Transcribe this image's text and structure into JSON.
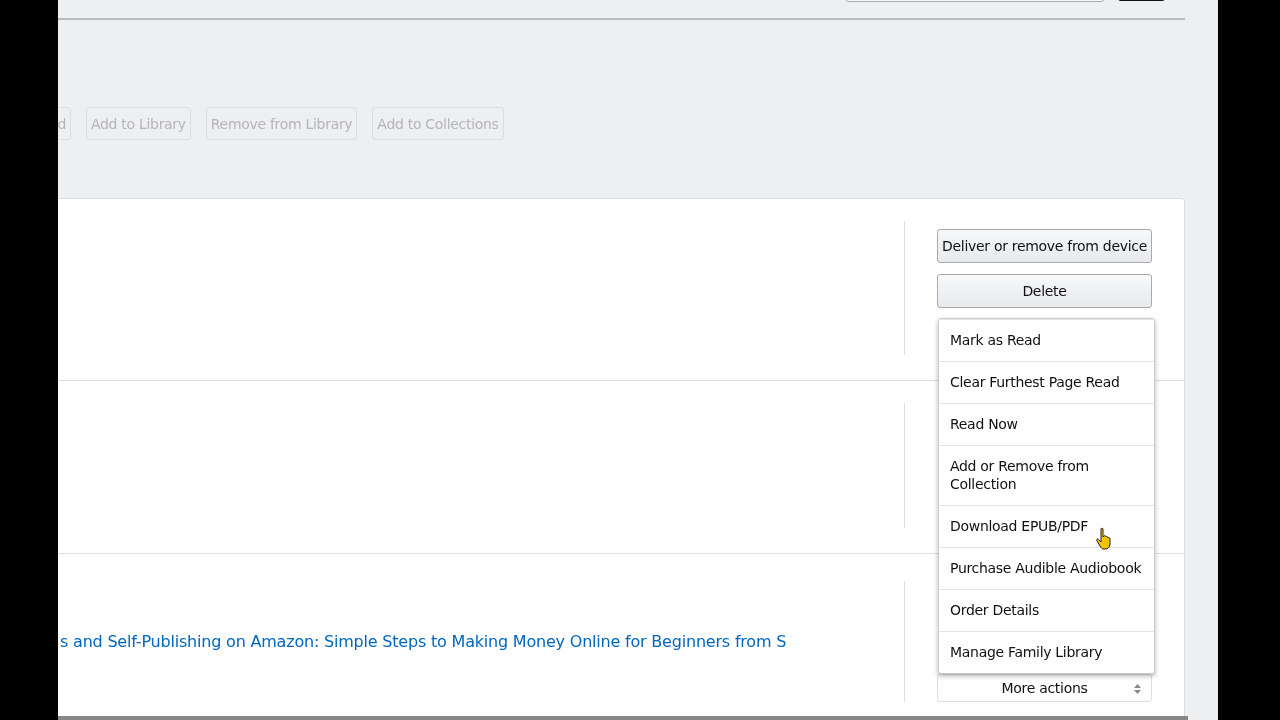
{
  "toolbar": {
    "buttons": [
      {
        "label": "d",
        "disabled": true
      },
      {
        "label": "Add to Library",
        "disabled": true
      },
      {
        "label": "Remove from Library",
        "disabled": true
      },
      {
        "label": "Add to Collections",
        "disabled": true
      }
    ]
  },
  "rows": [
    {
      "actions": [
        {
          "label": "Deliver or remove from device"
        },
        {
          "label": "Delete"
        }
      ]
    },
    {
      "actions": []
    },
    {
      "title": "s and Self-Publishing on Amazon: Simple Steps to Making Money Online for Beginners from S",
      "more_actions": "More actions"
    }
  ],
  "menu": {
    "items": [
      "Mark as Read",
      "Clear Furthest Page Read",
      "Read Now",
      "Add or Remove from Collection",
      "Download EPUB/PDF",
      "Purchase Audible Audiobook",
      "Order Details",
      "Manage Family Library"
    ]
  }
}
